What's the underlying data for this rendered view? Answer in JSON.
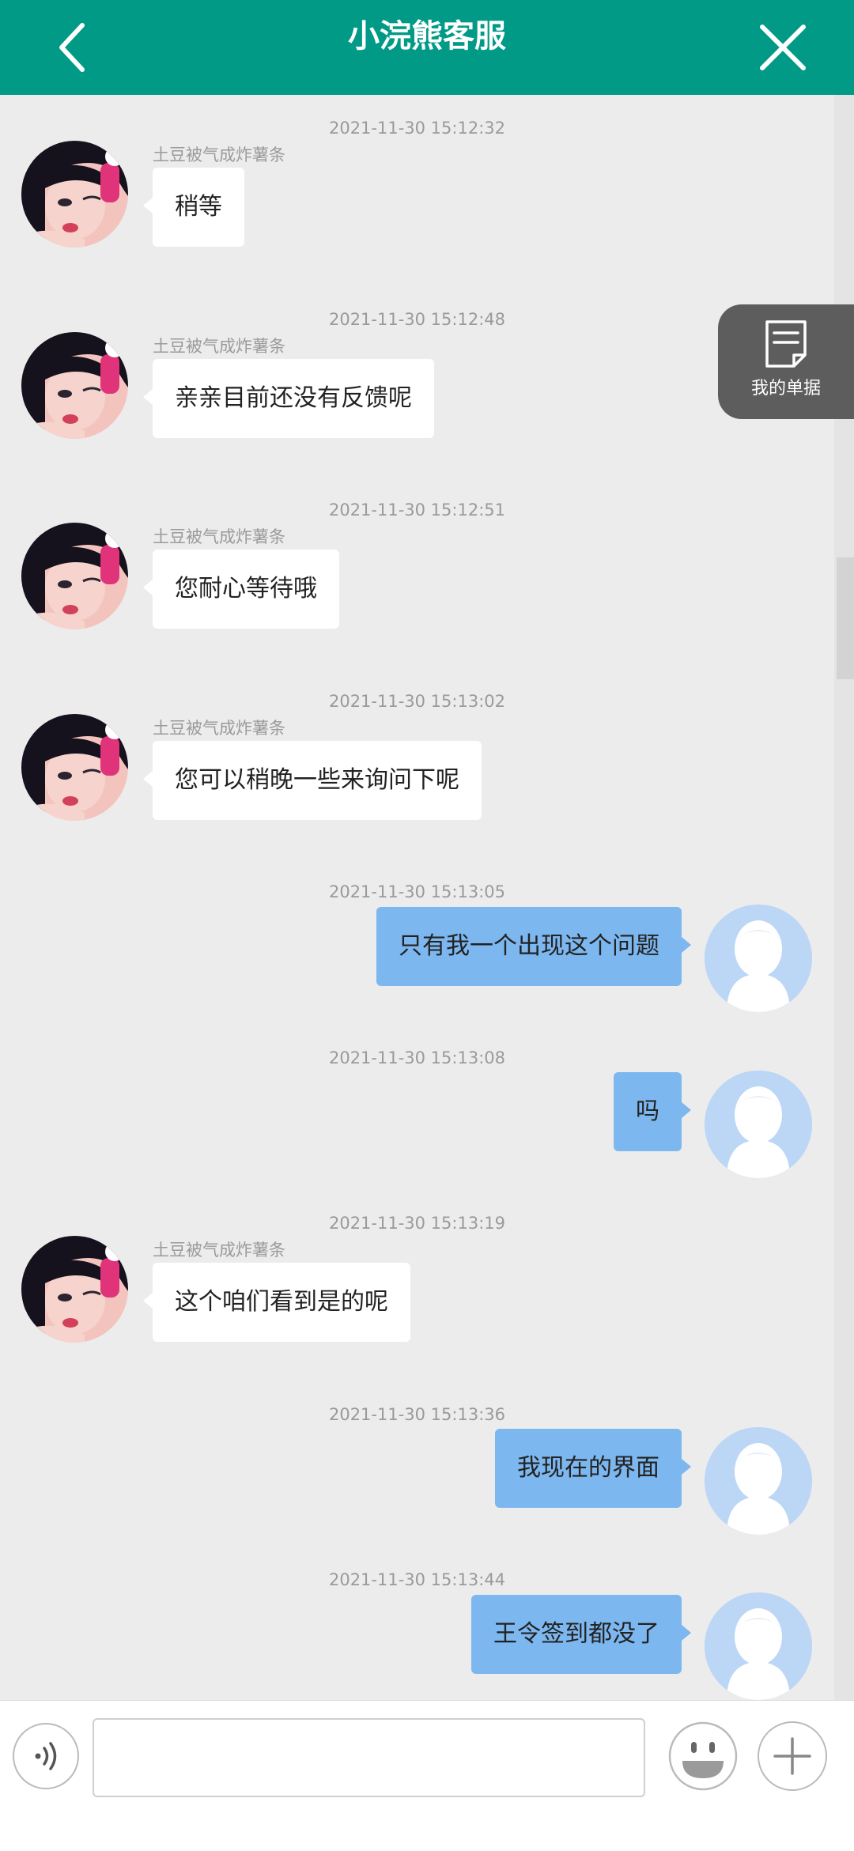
{
  "header": {
    "title": "小浣熊客服"
  },
  "floating": {
    "orders_label": "我的单据"
  },
  "messages": [
    {
      "time": "2021-11-30 15:12:32",
      "sender": "土豆被气成炸薯条",
      "text": "稍等"
    },
    {
      "time": "2021-11-30 15:12:48",
      "sender": "土豆被气成炸薯条",
      "text": "亲亲目前还没有反馈呢"
    },
    {
      "time": "2021-11-30 15:12:51",
      "sender": "土豆被气成炸薯条",
      "text": "您耐心等待哦"
    },
    {
      "time": "2021-11-30 15:13:02",
      "sender": "土豆被气成炸薯条",
      "text": "您可以稍晚一些来询问下呢"
    },
    {
      "time": "2021-11-30 15:13:05",
      "text": "只有我一个出现这个问题"
    },
    {
      "time": "2021-11-30 15:13:08",
      "text": "吗"
    },
    {
      "time": "2021-11-30 15:13:19",
      "sender": "土豆被气成炸薯条",
      "text": "这个咱们看到是的呢"
    },
    {
      "time": "2021-11-30 15:13:36",
      "text": "我现在的界面"
    },
    {
      "time": "2021-11-30 15:13:44",
      "text": "王令签到都没了"
    }
  ],
  "input": {
    "placeholder": ""
  },
  "colors": {
    "header": "#009a87",
    "outgoing_bubble": "#7db7ef",
    "incoming_bubble": "#ffffff",
    "background": "#ececec"
  }
}
